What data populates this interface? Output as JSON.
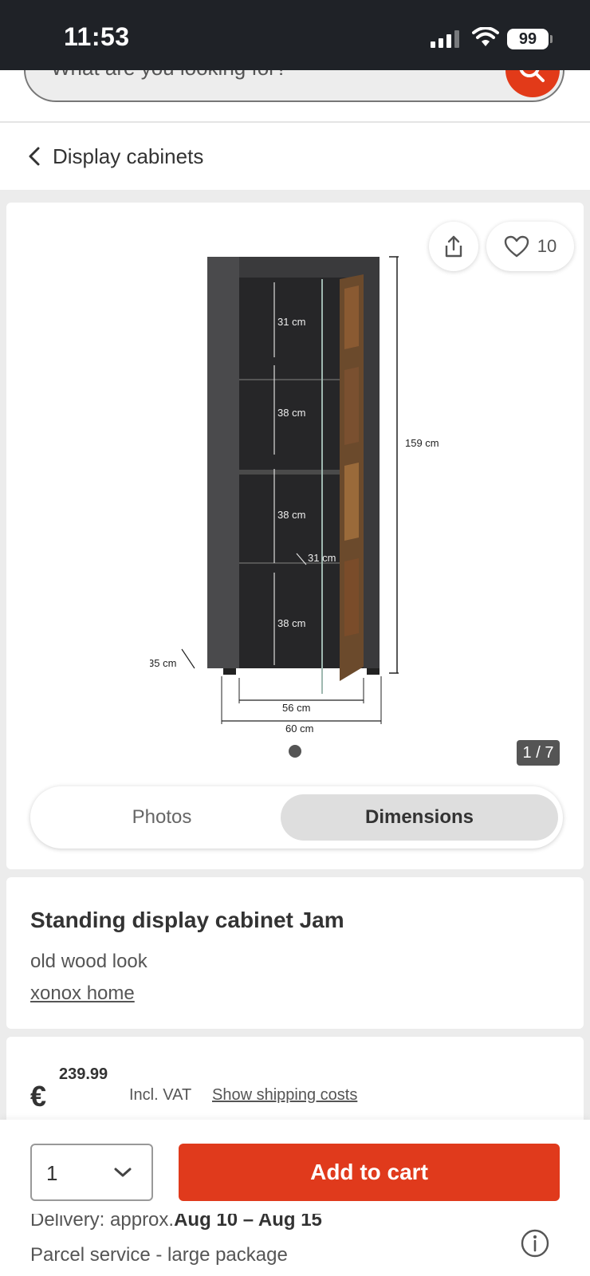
{
  "status_bar": {
    "time": "11:53",
    "battery": "99"
  },
  "search": {
    "placeholder": "What are you looking for?"
  },
  "breadcrumb": {
    "label": "Display cabinets"
  },
  "gallery": {
    "favorites_count": "10",
    "pager": "1 / 7",
    "tabs": [
      "Photos",
      "Dimensions"
    ],
    "selected_tab": "Dimensions",
    "dimension_labels": [
      "31 cm",
      "38 cm",
      "38 cm",
      "31 cm",
      "38 cm",
      "159 cm",
      "35 cm",
      "56 cm",
      "60 cm"
    ]
  },
  "product": {
    "title": "Standing display cabinet Jam",
    "subtitle": "old wood look",
    "brand": "xonox home"
  },
  "price": {
    "currency": "€",
    "amount": "239.99",
    "vat": "Incl. VAT",
    "shipping_link": "Show shipping costs"
  },
  "cart": {
    "quantity": "1",
    "add_label": "Add to cart",
    "delivery_prefix": "Delivery: approx.",
    "delivery_dates": "Aug 10 – Aug 15",
    "shipping_method": "Parcel service - large package"
  },
  "colors": {
    "accent": "#e03a1c",
    "status_bar": "#1f2227"
  },
  "icons": [
    "search-icon",
    "chevron-left-icon",
    "share-icon",
    "heart-icon",
    "chevron-down-icon",
    "info-icon"
  ]
}
